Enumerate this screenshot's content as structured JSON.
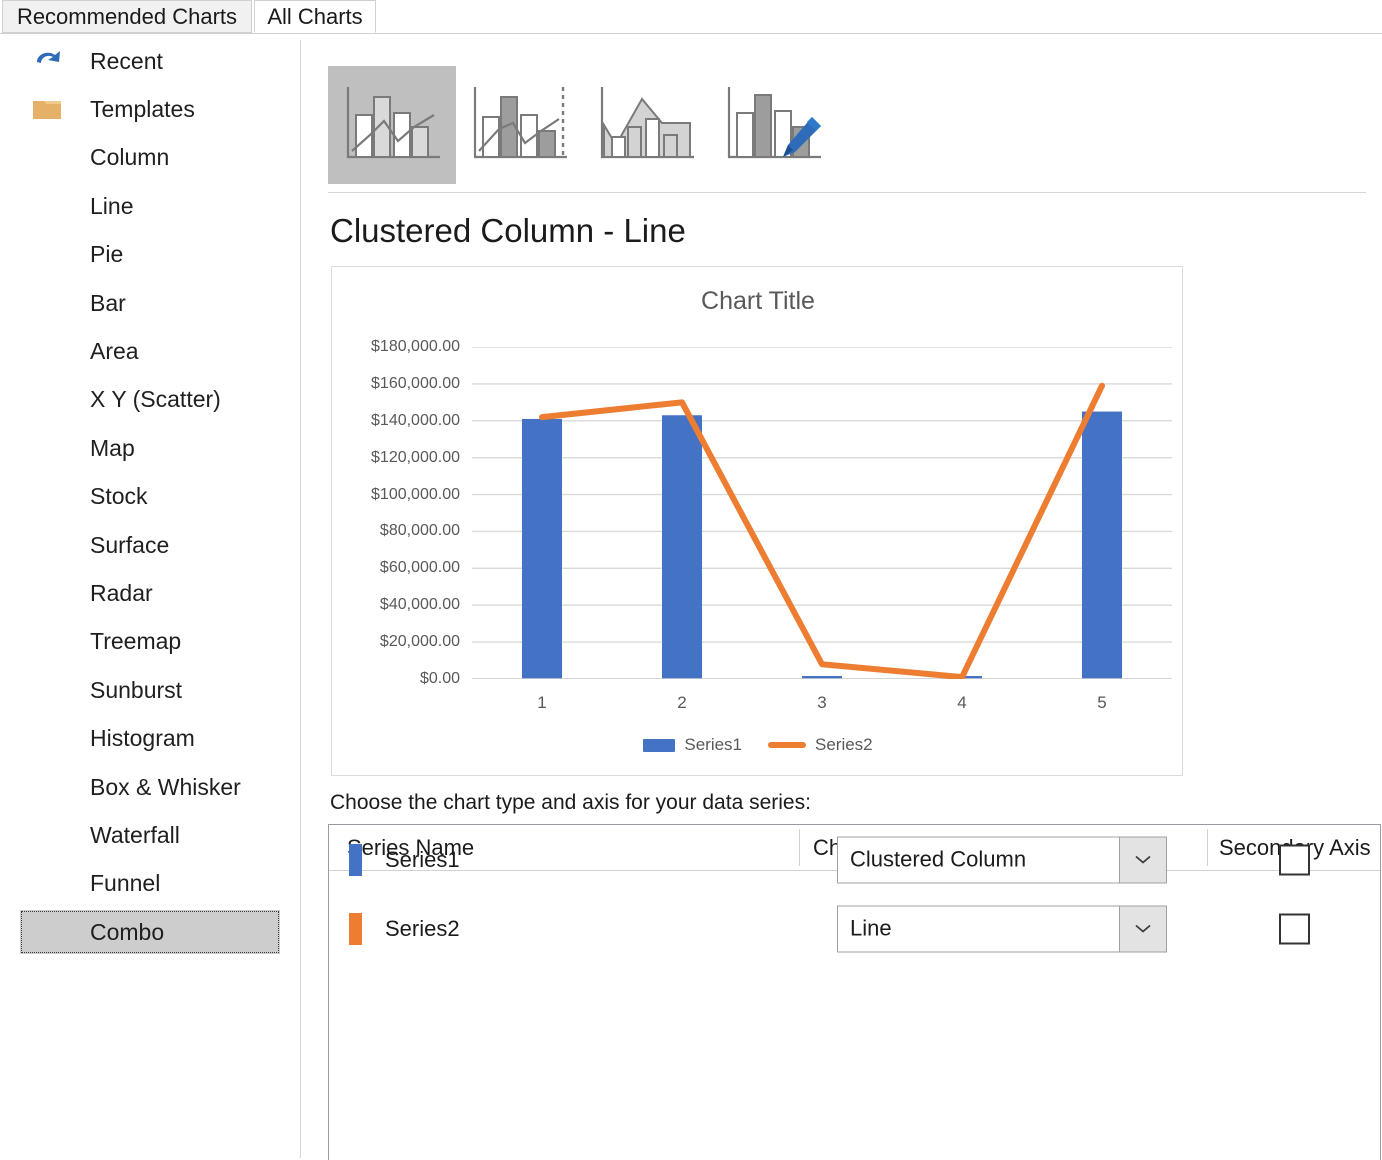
{
  "dialog": {
    "tabs": [
      {
        "label": "Recommended Charts",
        "active": false
      },
      {
        "label": "All Charts",
        "active": true
      }
    ]
  },
  "sidebar": {
    "items": [
      {
        "label": "Recent",
        "icon": "recent-undo-icon",
        "selected": false
      },
      {
        "label": "Templates",
        "icon": "folder-icon",
        "selected": false
      },
      {
        "label": "Column",
        "icon": "column-chart-icon",
        "selected": false
      },
      {
        "label": "Line",
        "icon": "line-chart-icon",
        "selected": false
      },
      {
        "label": "Pie",
        "icon": "pie-chart-icon",
        "selected": false
      },
      {
        "label": "Bar",
        "icon": "bar-chart-icon",
        "selected": false
      },
      {
        "label": "Area",
        "icon": "area-chart-icon",
        "selected": false
      },
      {
        "label": "X Y (Scatter)",
        "icon": "scatter-chart-icon",
        "selected": false
      },
      {
        "label": "Map",
        "icon": "map-globe-icon",
        "selected": false
      },
      {
        "label": "Stock",
        "icon": "stock-chart-icon",
        "selected": false
      },
      {
        "label": "Surface",
        "icon": "surface-chart-icon",
        "selected": false
      },
      {
        "label": "Radar",
        "icon": "radar-chart-icon",
        "selected": false
      },
      {
        "label": "Treemap",
        "icon": "treemap-chart-icon",
        "selected": false
      },
      {
        "label": "Sunburst",
        "icon": "sunburst-chart-icon",
        "selected": false
      },
      {
        "label": "Histogram",
        "icon": "histogram-chart-icon",
        "selected": false
      },
      {
        "label": "Box & Whisker",
        "icon": "boxwhisker-icon",
        "selected": false
      },
      {
        "label": "Waterfall",
        "icon": "waterfall-icon",
        "selected": false
      },
      {
        "label": "Funnel",
        "icon": "funnel-chart-icon",
        "selected": false
      },
      {
        "label": "Combo",
        "icon": "combo-chart-icon",
        "selected": true
      }
    ]
  },
  "gallery": {
    "thumbnails": [
      {
        "name": "clustered-column-line",
        "selected": true
      },
      {
        "name": "clustered-column-line-secondary-axis",
        "selected": false
      },
      {
        "name": "stacked-area-clustered-column",
        "selected": false
      },
      {
        "name": "custom-combination",
        "selected": false
      }
    ]
  },
  "subtype": {
    "title": "Clustered Column - Line"
  },
  "chart_data": {
    "type": "bar",
    "title": "Chart Title",
    "xlabel": "",
    "ylabel": "",
    "categories": [
      "1",
      "2",
      "3",
      "4",
      "5"
    ],
    "ylim": [
      0,
      180000
    ],
    "ytick_values": [
      0,
      20000,
      40000,
      60000,
      80000,
      100000,
      120000,
      140000,
      160000,
      180000
    ],
    "ytick_labels": [
      "$0.00",
      "$20,000.00",
      "$40,000.00",
      "$60,000.00",
      "$80,000.00",
      "$100,000.00",
      "$120,000.00",
      "$140,000.00",
      "$160,000.00",
      "$180,000.00"
    ],
    "grid": true,
    "legend_position": "bottom",
    "series": [
      {
        "name": "Series1",
        "kind": "column",
        "color": "#4472C4",
        "values": [
          141000,
          143000,
          1500,
          300,
          145000
        ]
      },
      {
        "name": "Series2",
        "kind": "line",
        "color": "#ED7D31",
        "values": [
          142000,
          150000,
          8000,
          1000,
          159000
        ]
      }
    ]
  },
  "series_panel": {
    "prompt": "Choose the chart type and axis for your data series:",
    "columns": {
      "series_name": "Series Name",
      "chart_type": "Chart Type",
      "secondary_axis": "Secondary Axis"
    },
    "rows": [
      {
        "name": "Series1",
        "color": "#4472C4",
        "chart_type": "Clustered Column",
        "secondary_axis": false
      },
      {
        "name": "Series2",
        "color": "#ED7D31",
        "chart_type": "Line",
        "secondary_axis": false
      }
    ]
  },
  "colors": {
    "series1": "#4472C4",
    "series2": "#ED7D31",
    "selection": "#CDCDCD",
    "gallery_selection": "#BFBFBF",
    "text": "#1B1B1B",
    "chart_text": "#595959",
    "gridline": "#D9D9D9"
  }
}
